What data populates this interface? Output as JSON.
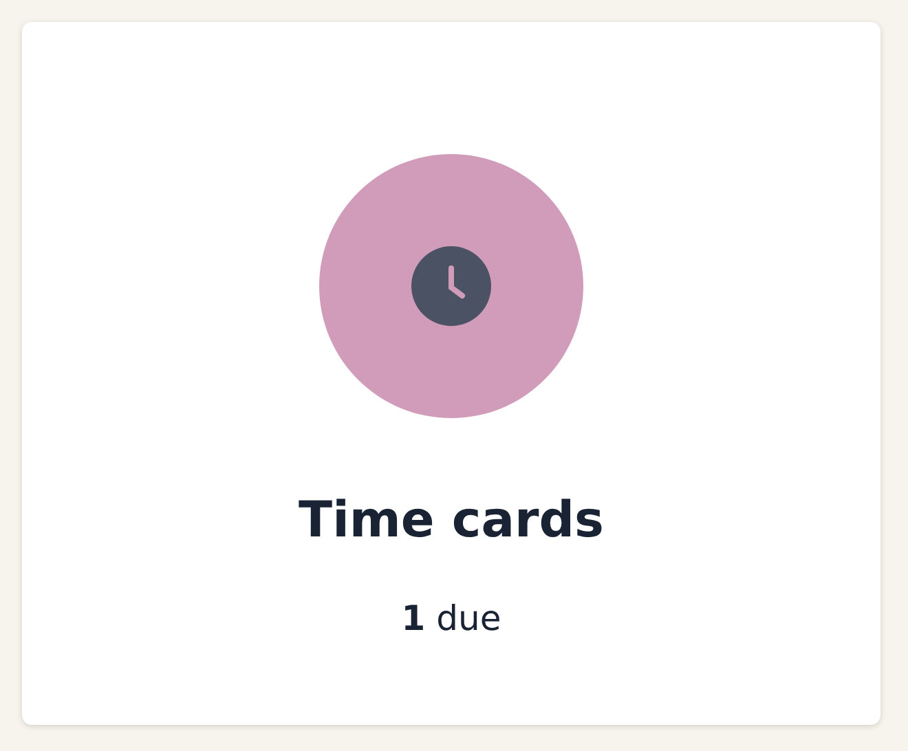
{
  "card": {
    "title": "Time cards",
    "subtitle": "**1** due"
  }
}
